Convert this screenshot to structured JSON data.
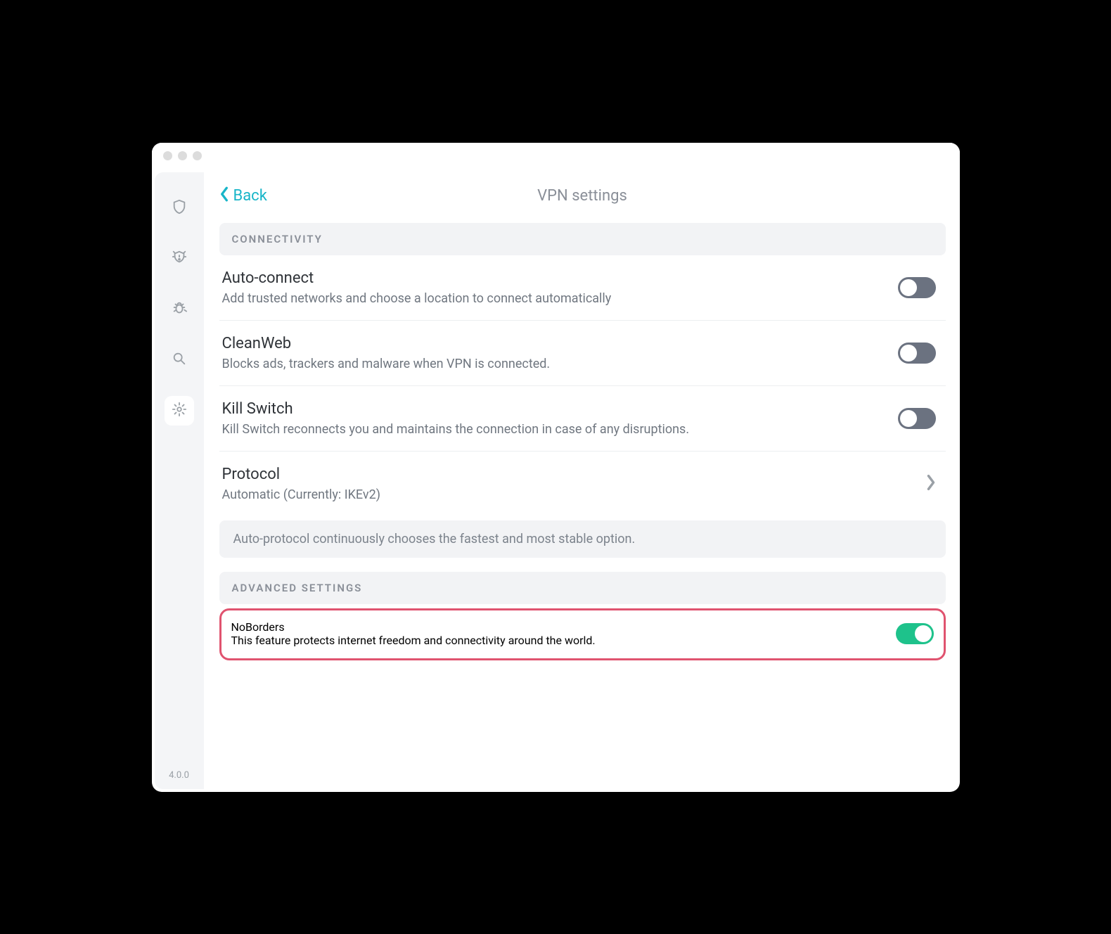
{
  "window": {
    "version": "4.0.0"
  },
  "header": {
    "back_label": "Back",
    "title": "VPN settings"
  },
  "sidebar": {
    "items": [
      {
        "name": "vpn",
        "icon": "shield-icon"
      },
      {
        "name": "alert",
        "icon": "alert-icon"
      },
      {
        "name": "antivirus",
        "icon": "bug-icon"
      },
      {
        "name": "search",
        "icon": "search-icon"
      },
      {
        "name": "settings",
        "icon": "gear-icon",
        "active": true
      }
    ]
  },
  "sections": {
    "connectivity": {
      "label": "CONNECTIVITY",
      "auto_connect": {
        "title": "Auto-connect",
        "desc": "Add trusted networks and choose a location to connect automatically",
        "on": false
      },
      "cleanweb": {
        "title": "CleanWeb",
        "desc": "Blocks ads, trackers and malware when VPN is connected.",
        "on": false
      },
      "killswitch": {
        "title": "Kill Switch",
        "desc": "Kill Switch reconnects you and maintains the connection in case of any disruptions.",
        "on": false
      },
      "protocol": {
        "title": "Protocol",
        "desc": "Automatic (Currently: IKEv2)",
        "note": "Auto-protocol continuously chooses the fastest and most stable option."
      }
    },
    "advanced": {
      "label": "ADVANCED SETTINGS",
      "noborders": {
        "title": "NoBorders",
        "desc": "This feature protects internet freedom and connectivity around the world.",
        "on": true
      }
    }
  }
}
